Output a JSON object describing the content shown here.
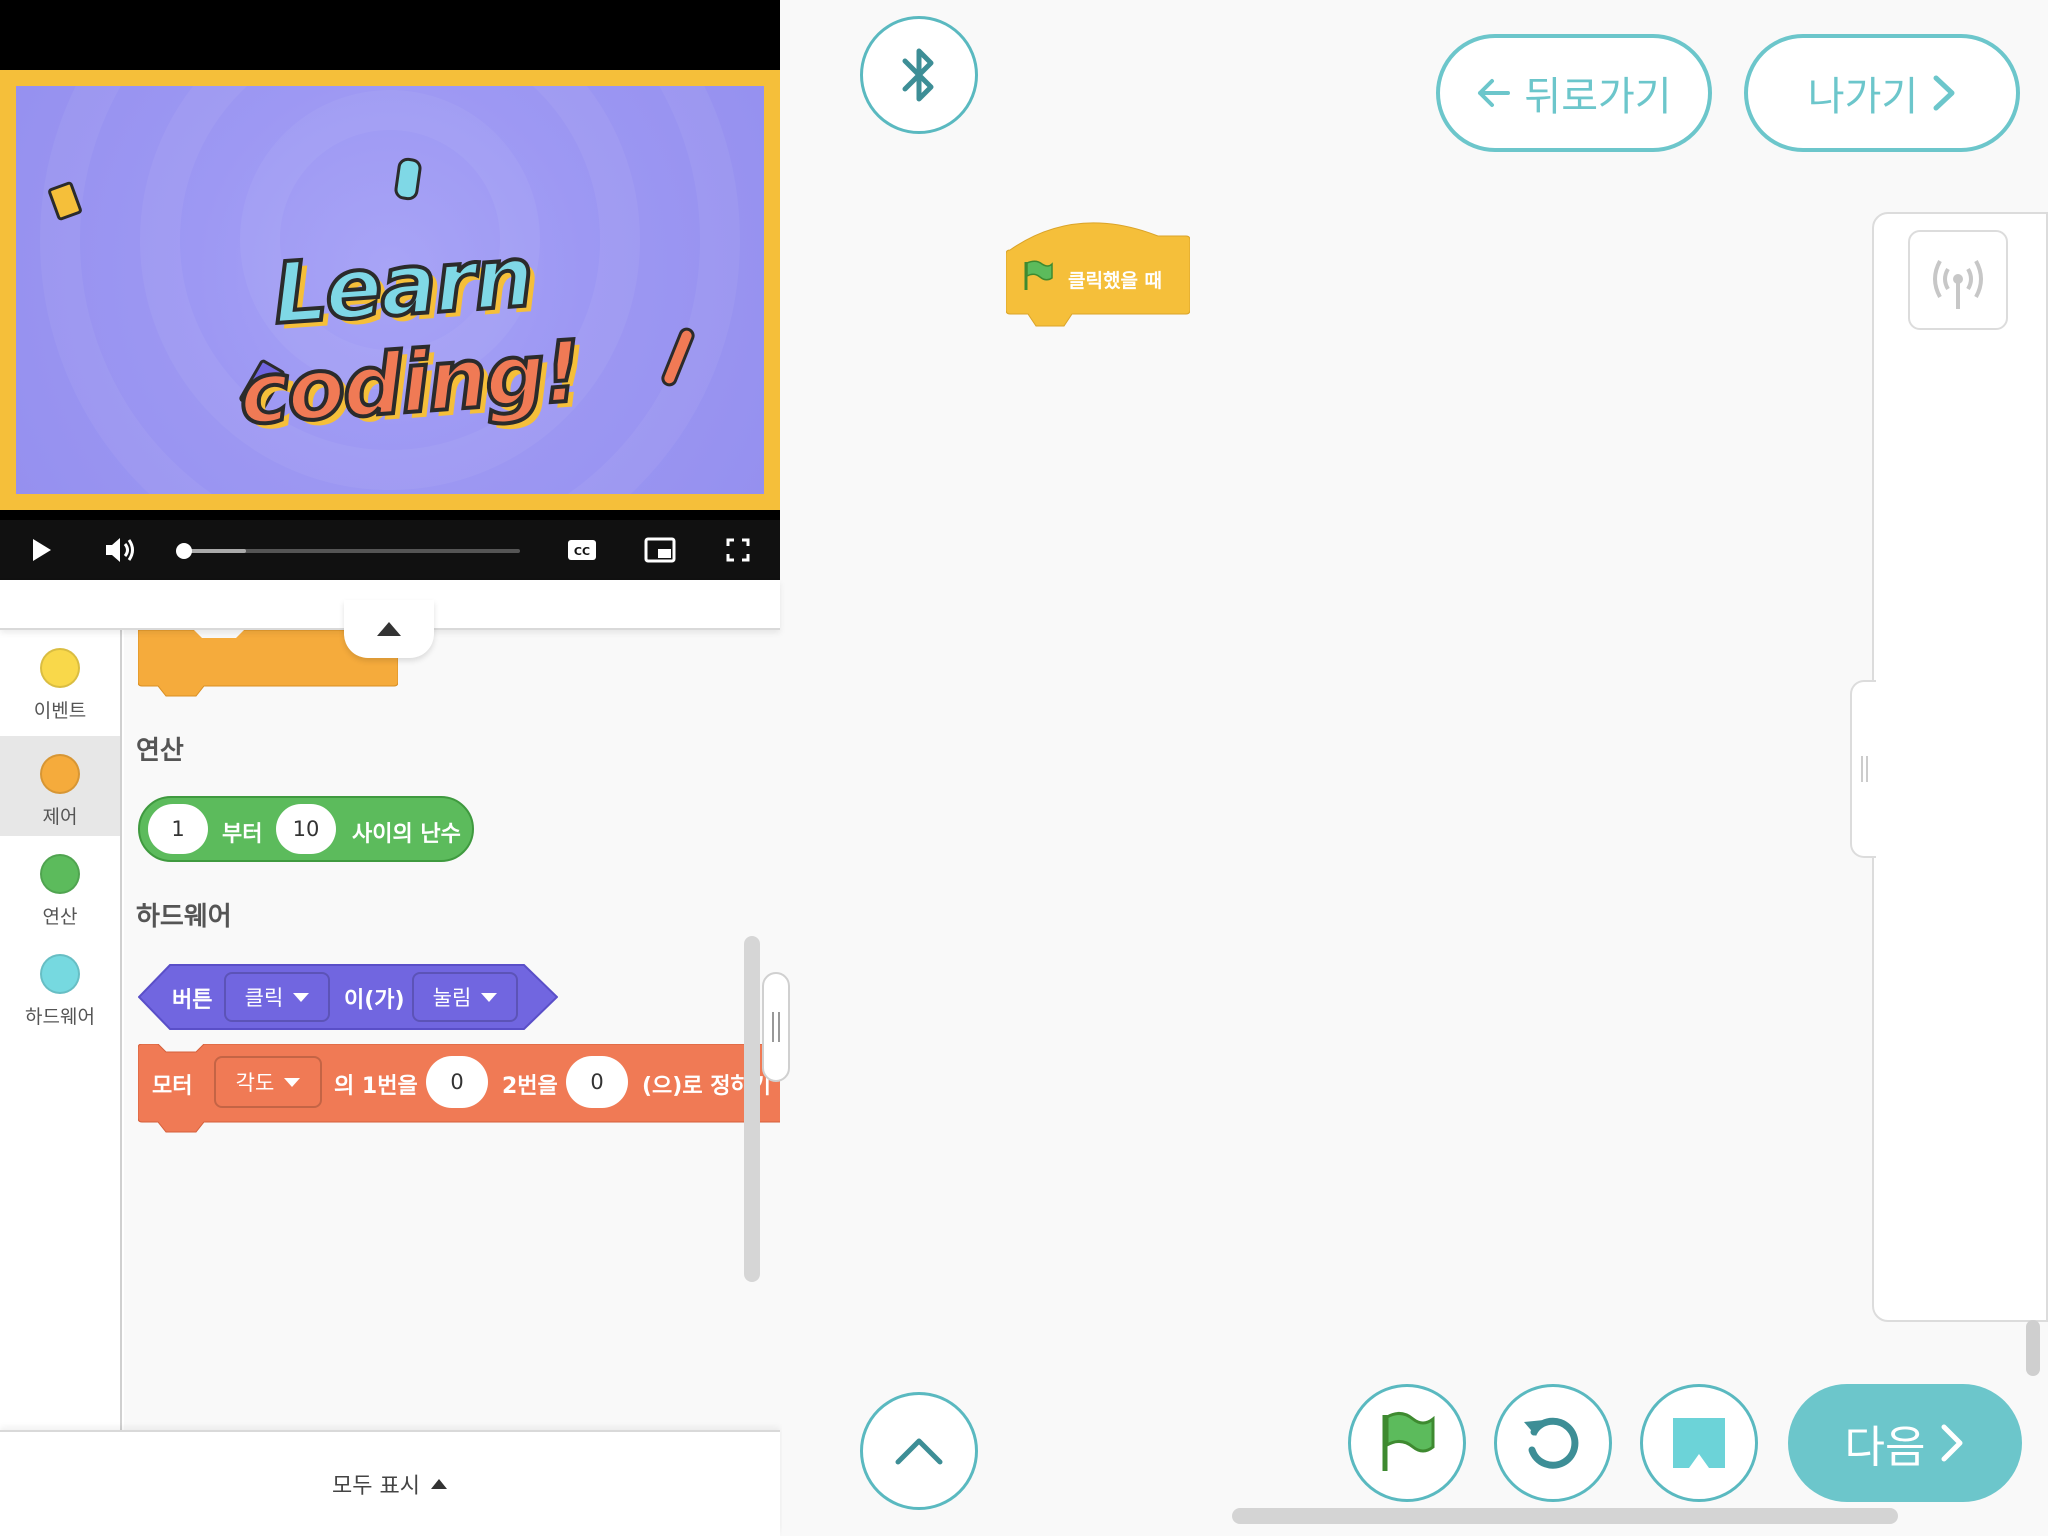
{
  "video": {
    "title_part1": "Learn",
    "title_part2": "coding!",
    "progress_fraction": 0.19
  },
  "palette": {
    "categories": [
      {
        "label": "이벤트",
        "color": "#f9d84a"
      },
      {
        "label": "제어",
        "color": "#f5ab3c"
      },
      {
        "label": "연산",
        "color": "#5cbb5c"
      },
      {
        "label": "하드웨어",
        "color": "#76d9e0"
      }
    ],
    "active_category": "제어",
    "sections": {
      "operators": "연산",
      "hardware": "하드웨어"
    },
    "random_block": {
      "from_value": "1",
      "from_label": "부터",
      "to_value": "10",
      "to_label": "사이의 난수",
      "color": "#5cbb5c"
    },
    "button_block": {
      "label": "버튼",
      "dropdown1": "클릭",
      "middle": "이(가)",
      "dropdown2": "눌림",
      "color": "#7166e0"
    },
    "motor_block": {
      "label": "모터",
      "dropdown": "각도",
      "text1": "의 1번을",
      "value1": "0",
      "text2": "2번을",
      "value2": "0",
      "text3": "(으)로 정하기",
      "color": "#f07a55"
    },
    "control_color": "#f5ab3c",
    "show_all": "모두 표시"
  },
  "toolbar": {
    "back_label": "뒤로가기",
    "exit_label": "나가기",
    "next_label": "다음"
  },
  "workspace": {
    "hat_block_label": "클릭했을 때",
    "hat_color": "#f5bf3a"
  },
  "colors": {
    "accent": "#6cc6cb",
    "accent_dark": "#3d8e96"
  },
  "icons": {
    "bluetooth": "bluetooth-icon",
    "flag": "green-flag-icon",
    "reset": "reset-icon",
    "stop": "stop-icon",
    "up": "chevron-up-icon",
    "broadcast": "broadcast-icon"
  }
}
